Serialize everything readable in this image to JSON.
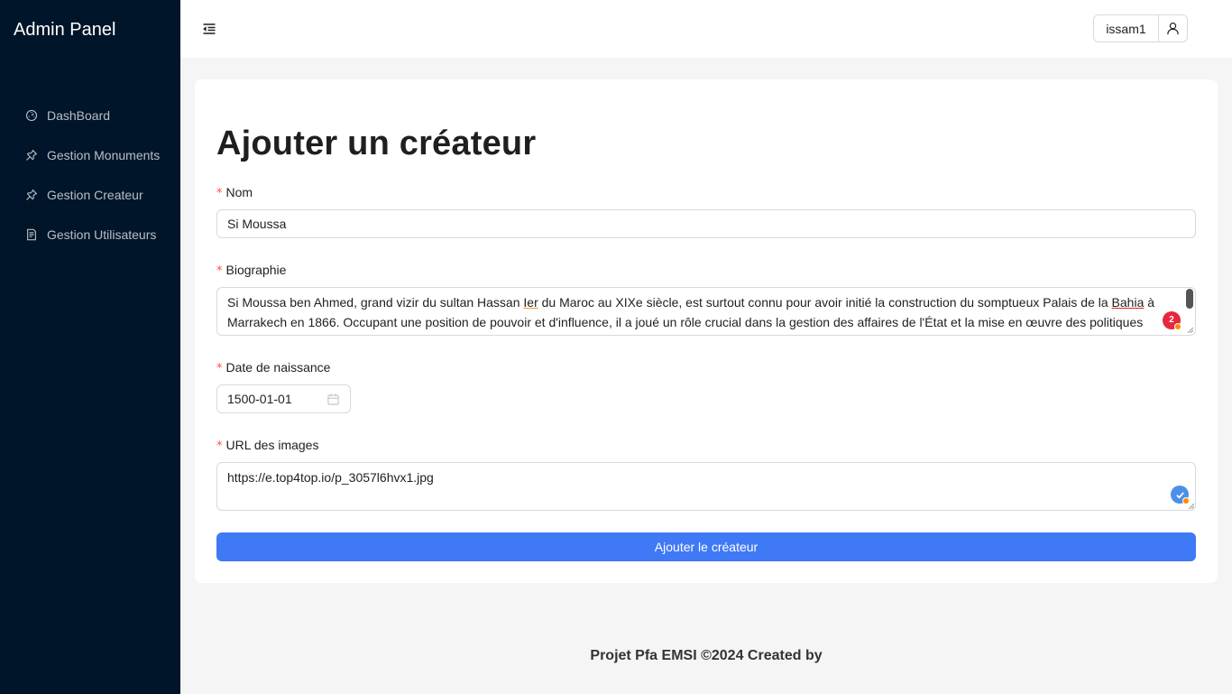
{
  "app": {
    "title": "Admin Panel"
  },
  "sidebar": {
    "items": [
      {
        "label": "DashBoard",
        "icon": "dashboard-icon"
      },
      {
        "label": "Gestion Monuments",
        "icon": "pushpin-icon"
      },
      {
        "label": "Gestion Createur",
        "icon": "pushpin-icon"
      },
      {
        "label": "Gestion Utilisateurs",
        "icon": "file-text-icon"
      }
    ]
  },
  "header": {
    "menu_toggle_icon": "menu-fold-icon",
    "user": {
      "name": "issam1",
      "icon": "user-icon"
    }
  },
  "form": {
    "title": "Ajouter un créateur",
    "required_mark": "*",
    "nom": {
      "label": "Nom",
      "value": "Si Moussa"
    },
    "biographie": {
      "label": "Biographie",
      "text_parts": [
        "Si Moussa ben Ahmed, grand vizir du sultan Hassan ",
        "Ier",
        " du Maroc au XIXe siècle, est surtout connu pour avoir initié la construction du somptueux Palais de la ",
        "Bahia",
        " à Marrakech en 1866. Occupant une position de pouvoir et d'influence, il a joué un rôle crucial dans la gestion des affaires de l'État et la mise en œuvre des politiques"
      ],
      "grammar_badge_count": "2"
    },
    "date_naissance": {
      "label": "Date de naissance",
      "value": "1500-01-01",
      "icon": "calendar-icon"
    },
    "url_images": {
      "label": "URL des images",
      "value": "https://e.top4top.io/p_3057l6hvx1.jpg"
    },
    "submit_label": "Ajouter le créateur"
  },
  "footer": {
    "text": "Projet Pfa EMSI ©2024 Created by"
  },
  "colors": {
    "sidebar_bg": "#001529",
    "primary": "#4079f6",
    "required": "#ff4d4f",
    "page_bg": "#f5f5f5",
    "grammar_badge_red": "#e5283f",
    "grammar_badge_blue": "#4a90e8"
  }
}
